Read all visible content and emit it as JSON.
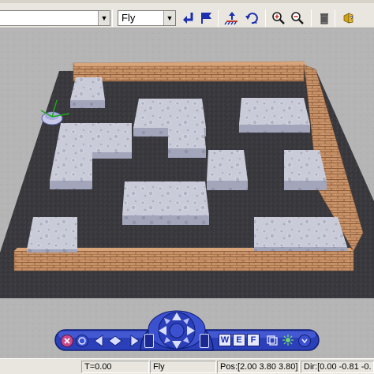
{
  "toolbar": {
    "navigation_mode": "Fly",
    "buttons": [
      {
        "name": "go-to-viewpoint-icon"
      },
      {
        "name": "flag-viewpoint-icon"
      },
      {
        "name": "restore-viewpoint-icon"
      },
      {
        "name": "undo-move-icon"
      },
      {
        "name": "zoom-in-icon"
      },
      {
        "name": "zoom-out-icon"
      },
      {
        "name": "delete-icon"
      },
      {
        "name": "help-icon"
      }
    ]
  },
  "navigation_panel": {
    "buttons": [
      {
        "label": "W",
        "name": "walk-mode-button"
      },
      {
        "label": "E",
        "name": "examine-mode-button"
      },
      {
        "label": "F",
        "name": "fly-mode-button"
      }
    ],
    "colors": {
      "panel": "#2a3fb8",
      "panel_light": "#5a6fe6",
      "panel_dark": "#101e74"
    }
  },
  "status": {
    "time": "T=0.00",
    "mode": "Fly",
    "position": "Pos:[2.00 3.80 3.80]",
    "direction": "Dir:[0.00 -0.81 -0."
  },
  "scene": {
    "colors": {
      "floor": "#38383d",
      "ground": "#b5b5b5",
      "wall": "#c89268",
      "wall_mortar": "#9a6a48",
      "block_top": "#c9cbd8",
      "block_side": "#9ea0b6"
    }
  }
}
